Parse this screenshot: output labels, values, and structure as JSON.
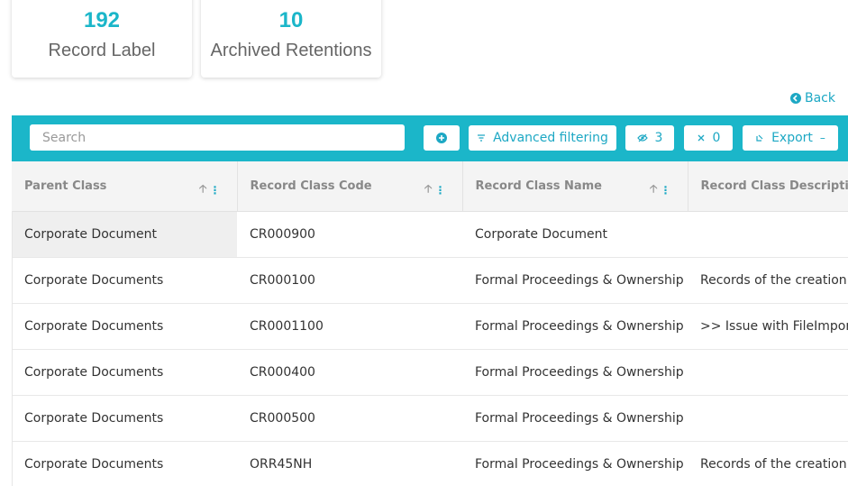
{
  "stats": [
    {
      "value": "192",
      "label": "Record Label"
    },
    {
      "value": "10",
      "label": "Archived Retentions"
    }
  ],
  "back_label": "Back",
  "toolbar": {
    "search_placeholder": "Search",
    "advanced_filtering_label": "Advanced filtering",
    "hidden_count": "3",
    "pinned_count": "0",
    "export_label": "Export"
  },
  "table": {
    "columns": [
      "Parent Class",
      "Record Class Code",
      "Record Class Name",
      "Record Class Description"
    ],
    "rows": [
      [
        "Corporate Document",
        "CR000900",
        "Corporate Document",
        ""
      ],
      [
        "Corporate Documents",
        "CR000100",
        "Formal Proceedings & Ownership",
        "Records of the creation a"
      ],
      [
        "Corporate Documents",
        "CR0001100",
        "Formal Proceedings & Ownership",
        ">> Issue with FileImport -"
      ],
      [
        "Corporate Documents",
        "CR000400",
        "Formal Proceedings & Ownership",
        ""
      ],
      [
        "Corporate Documents",
        "CR000500",
        "Formal Proceedings & Ownership",
        ""
      ],
      [
        "Corporate Documents",
        "ORR45NH",
        "Formal Proceedings & Ownership",
        "Records of the creation a"
      ]
    ]
  },
  "colors": {
    "accent": "#1bb6c9",
    "link": "#1da8c4"
  }
}
